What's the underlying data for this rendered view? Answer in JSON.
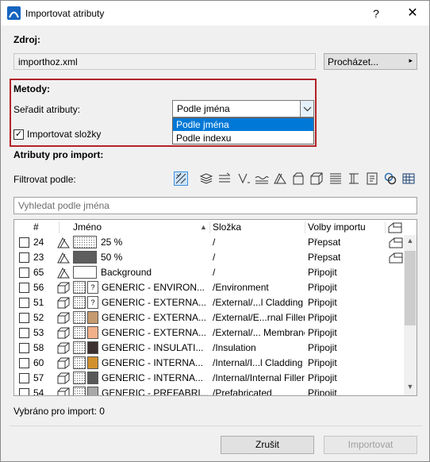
{
  "window": {
    "title": "Importovat atributy",
    "help": "?",
    "close": "✕"
  },
  "source": {
    "heading": "Zdroj:",
    "file": "importhoz.xml",
    "browse": "Procházet...",
    "browse_arrow": "▸"
  },
  "methods": {
    "heading": "Metody:",
    "sort_label": "Seřadit atributy:",
    "sort_value": "Podle jména",
    "sort_arrow": "⌄",
    "options": [
      "Podle jména",
      "Podle indexu"
    ],
    "selected_option": 0,
    "import_folders_label": "Importovat složky",
    "import_folders_checked": true,
    "check_mark": "✓"
  },
  "attributes": {
    "heading": "Atributy pro import:",
    "filter_label": "Filtrovat podle:",
    "filter_icons": [
      "all-attributes-icon",
      "layers-icon",
      "pens-icon",
      "line-types-icon",
      "fill-types-icon",
      "composites-icon",
      "profiles-icon",
      "building-materials-icon",
      "surfaces-icon",
      "zones-icon",
      "layer-combinations-icon",
      "markup-styles-icon",
      "operation-profiles-icon"
    ],
    "search_placeholder": "Vyhledat podle jména"
  },
  "table": {
    "columns": {
      "index": "#",
      "name": "Jméno",
      "sort_arrow": "▲",
      "folder": "Složka",
      "options": "Volby importu",
      "extra_icon": "house-icon"
    },
    "rows": [
      {
        "index": "24",
        "name": "25 %",
        "folder": "/",
        "option": "Přepsat",
        "type": "fill",
        "swatch": "#e8e8e8",
        "pattern": "dots-light",
        "extra": true
      },
      {
        "index": "23",
        "name": "50 %",
        "folder": "/",
        "option": "Přepsat",
        "type": "fill",
        "swatch": "#bdbdbd",
        "pattern": "dots-dense",
        "extra": true
      },
      {
        "index": "65",
        "name": "Background",
        "folder": "/",
        "option": "Připojit",
        "type": "fill",
        "swatch": "#ffffff",
        "pattern": "none",
        "extra": false
      },
      {
        "index": "56",
        "name": "GENERIC - ENVIRON...",
        "folder": "/Environment",
        "option": "Připojit",
        "type": "building-material",
        "swatch": "#ffffff",
        "pattern": "question",
        "extra": false
      },
      {
        "index": "51",
        "name": "GENERIC - EXTERNA...",
        "folder": "/External/...l Cladding",
        "option": "Připojit",
        "type": "building-material",
        "swatch": "#ffffff",
        "pattern": "question",
        "extra": false
      },
      {
        "index": "52",
        "name": "GENERIC - EXTERNA...",
        "folder": "/External/E...rnal Filler",
        "option": "Připojit",
        "type": "building-material",
        "swatch": "#c59a6e",
        "pattern": "solid",
        "extra": false
      },
      {
        "index": "53",
        "name": "GENERIC - EXTERNA...",
        "folder": "/External/... Membrane",
        "option": "Připojit",
        "type": "building-material",
        "swatch": "#f2b08a",
        "pattern": "solid",
        "extra": false
      },
      {
        "index": "58",
        "name": "GENERIC - INSULATI...",
        "folder": "/Insulation",
        "option": "Připojit",
        "type": "building-material",
        "swatch": "#3c3030",
        "pattern": "solid",
        "extra": false
      },
      {
        "index": "60",
        "name": "GENERIC - INTERNA...",
        "folder": "/Internal/I...l Cladding",
        "option": "Připojit",
        "type": "building-material",
        "swatch": "#d2912f",
        "pattern": "solid",
        "extra": false
      },
      {
        "index": "57",
        "name": "GENERIC - INTERNA...",
        "folder": "/Internal/Internal Filler",
        "option": "Připojit",
        "type": "building-material",
        "swatch": "#585858",
        "pattern": "solid",
        "extra": false
      },
      {
        "index": "54",
        "name": "GENERIC - PREFABRI...",
        "folder": "/Prefabricated",
        "option": "Připojit",
        "type": "building-material",
        "swatch": "#a8a8a8",
        "pattern": "solid",
        "extra": false
      }
    ],
    "scroll_up": "▲",
    "scroll_down": "▼"
  },
  "footer": {
    "selected_label": "Vybráno pro import: 0",
    "cancel": "Zrušit",
    "import": "Importovat"
  },
  "colors": {
    "highlight_frame": "#b22329",
    "selection_blue": "#0078d7"
  }
}
